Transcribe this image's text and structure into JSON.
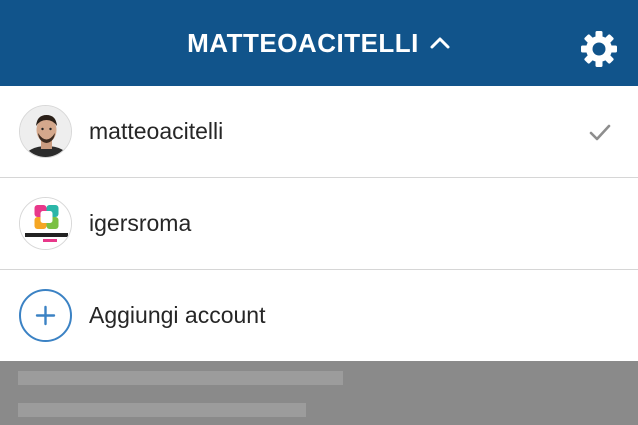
{
  "header": {
    "title": "MATTEOACITELLI",
    "chevron_icon": "chevron-up-icon",
    "settings_icon": "gear-icon"
  },
  "accounts": [
    {
      "username": "matteoacitelli",
      "selected": true,
      "avatar_icon": "profile-photo"
    },
    {
      "username": "igersroma",
      "selected": false,
      "avatar_icon": "instagramers-logo"
    }
  ],
  "add_account": {
    "label": "Aggiungi account",
    "icon": "plus-circle-icon"
  },
  "colors": {
    "header_bg": "#11548b",
    "accent_blue": "#3b82c4",
    "check_gray": "#8e8e8e",
    "backdrop": "#8a8a8a"
  }
}
